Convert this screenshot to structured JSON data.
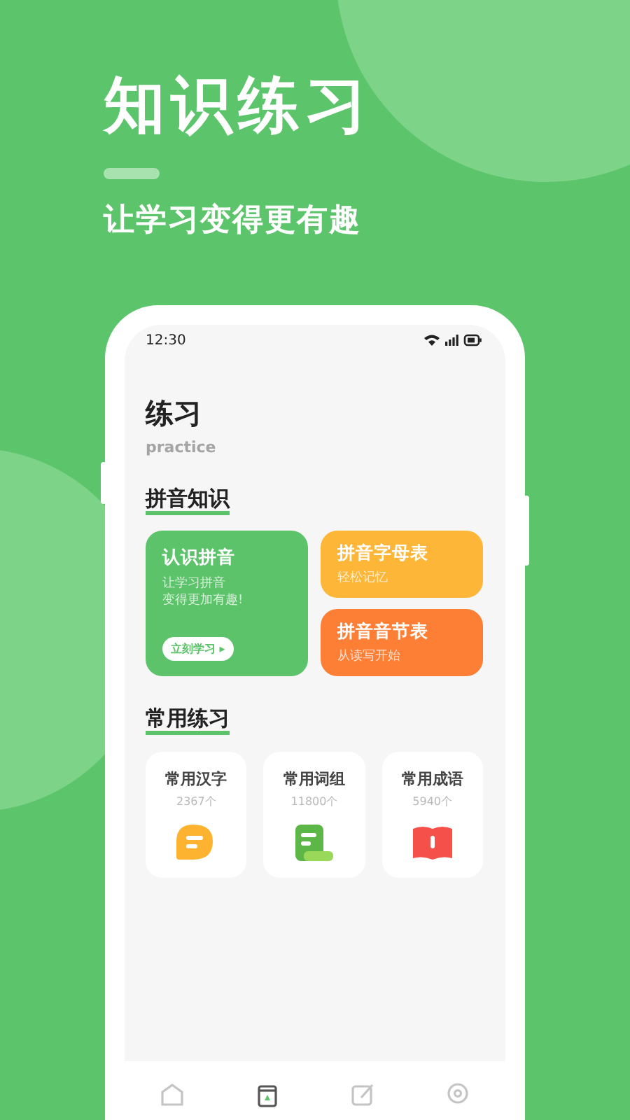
{
  "headline": "知识练习",
  "tagline": "让学习变得更有趣",
  "status_bar": {
    "time": "12:30"
  },
  "page": {
    "title": "练习",
    "subtitle": "practice"
  },
  "pinyin_section": {
    "title": "拼音知识",
    "main_card": {
      "title": "认识拼音",
      "lines": [
        "让学习拼音",
        "变得更加有趣!"
      ],
      "button": "立刻学习 ▸",
      "color": "#5cc36a"
    },
    "side_cards": [
      {
        "title": "拼音字母表",
        "subtitle": "轻松记忆",
        "color": "#fdb637"
      },
      {
        "title": "拼音音节表",
        "subtitle": "从读写开始",
        "color": "#fd7f36"
      }
    ]
  },
  "practice_section": {
    "title": "常用练习",
    "cards": [
      {
        "title": "常用汉字",
        "count": "2367个",
        "kind": "chat"
      },
      {
        "title": "常用词组",
        "count": "11800个",
        "kind": "scroll"
      },
      {
        "title": "常用成语",
        "count": "5940个",
        "kind": "book"
      }
    ]
  },
  "tab_bar": [
    {
      "kind": "home",
      "selected": false
    },
    {
      "kind": "book",
      "selected": true
    },
    {
      "kind": "edit",
      "selected": false
    },
    {
      "kind": "location",
      "selected": false
    }
  ]
}
